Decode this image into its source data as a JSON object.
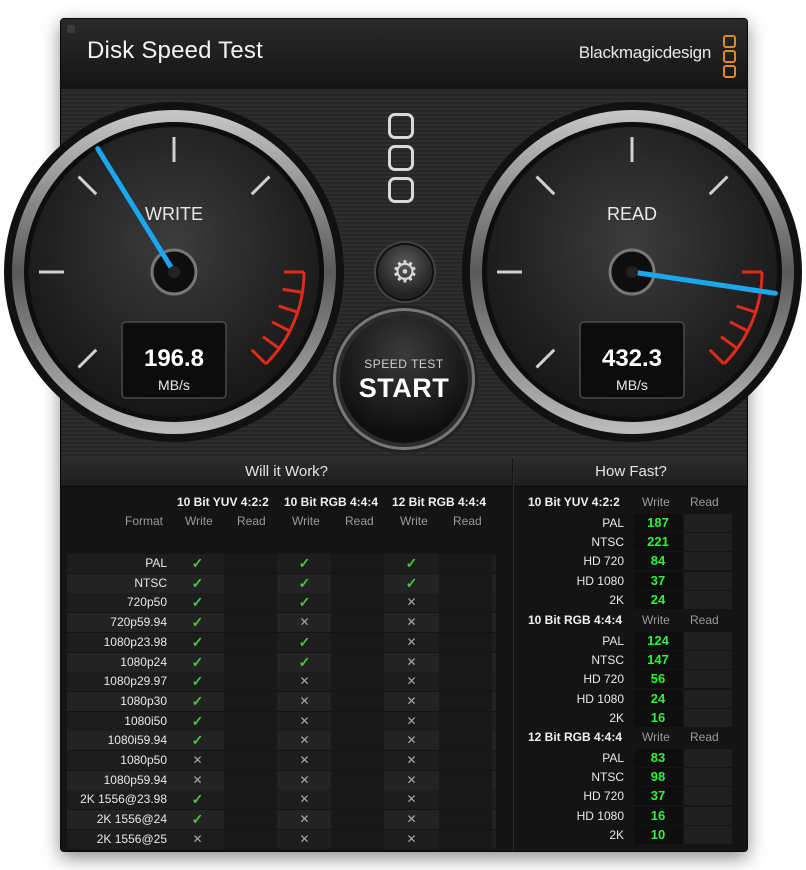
{
  "app": {
    "title": "Disk Speed Test",
    "brand": "Blackmagicdesign"
  },
  "gauges": {
    "write": {
      "label": "WRITE",
      "value": "196.8",
      "unit": "MB/s"
    },
    "read": {
      "label": "READ",
      "value": "432.3",
      "unit": "MB/s"
    }
  },
  "start_button": {
    "sub_label": "SPEED TEST",
    "label": "START"
  },
  "will_it_work": {
    "title": "Will it Work?",
    "format_header": "Format",
    "groups": [
      "10 Bit YUV 4:2:2",
      "10 Bit RGB 4:4:4",
      "12 Bit RGB 4:4:4"
    ],
    "columns": [
      "Write",
      "Read",
      "Write",
      "Read",
      "Write",
      "Read"
    ],
    "rows": [
      {
        "format": "PAL",
        "marks": [
          "ok",
          "ok",
          "ok"
        ]
      },
      {
        "format": "NTSC",
        "marks": [
          "ok",
          "ok",
          "ok"
        ]
      },
      {
        "format": "720p50",
        "marks": [
          "ok",
          "ok",
          "no"
        ]
      },
      {
        "format": "720p59.94",
        "marks": [
          "ok",
          "no",
          "no"
        ]
      },
      {
        "format": "1080p23.98",
        "marks": [
          "ok",
          "ok",
          "no"
        ]
      },
      {
        "format": "1080p24",
        "marks": [
          "ok",
          "ok",
          "no"
        ]
      },
      {
        "format": "1080p29.97",
        "marks": [
          "ok",
          "no",
          "no"
        ]
      },
      {
        "format": "1080p30",
        "marks": [
          "ok",
          "no",
          "no"
        ]
      },
      {
        "format": "1080i50",
        "marks": [
          "ok",
          "no",
          "no"
        ]
      },
      {
        "format": "1080i59.94",
        "marks": [
          "ok",
          "no",
          "no"
        ]
      },
      {
        "format": "1080p50",
        "marks": [
          "no",
          "no",
          "no"
        ]
      },
      {
        "format": "1080p59.94",
        "marks": [
          "no",
          "no",
          "no"
        ]
      },
      {
        "format": "2K 1556@23.98",
        "marks": [
          "ok",
          "no",
          "no"
        ]
      },
      {
        "format": "2K 1556@24",
        "marks": [
          "ok",
          "no",
          "no"
        ]
      },
      {
        "format": "2K 1556@25",
        "marks": [
          "no",
          "no",
          "no"
        ]
      }
    ]
  },
  "how_fast": {
    "title": "How Fast?",
    "write_label": "Write",
    "read_label": "Read",
    "groups": [
      {
        "name": "10 Bit YUV 4:2:2",
        "rows": [
          {
            "format": "PAL",
            "write": "187"
          },
          {
            "format": "NTSC",
            "write": "221"
          },
          {
            "format": "HD 720",
            "write": "84"
          },
          {
            "format": "HD 1080",
            "write": "37"
          },
          {
            "format": "2K",
            "write": "24"
          }
        ]
      },
      {
        "name": "10 Bit RGB 4:4:4",
        "rows": [
          {
            "format": "PAL",
            "write": "124"
          },
          {
            "format": "NTSC",
            "write": "147"
          },
          {
            "format": "HD 720",
            "write": "56"
          },
          {
            "format": "HD 1080",
            "write": "24"
          },
          {
            "format": "2K",
            "write": "16"
          }
        ]
      },
      {
        "name": "12 Bit RGB 4:4:4",
        "rows": [
          {
            "format": "PAL",
            "write": "83"
          },
          {
            "format": "NTSC",
            "write": "98"
          },
          {
            "format": "HD 720",
            "write": "37"
          },
          {
            "format": "HD 1080",
            "write": "16"
          },
          {
            "format": "2K",
            "write": "10"
          }
        ]
      }
    ]
  },
  "colors": {
    "needle": "#1aa7f0",
    "ok_mark": "#46c83a",
    "speed_value": "#2ff23a",
    "brand_mark": "#e08a1e",
    "redline": "#e02a1a"
  },
  "icons": {
    "settings": "gear-icon",
    "ok": "check-icon",
    "fail": "cross-icon"
  }
}
